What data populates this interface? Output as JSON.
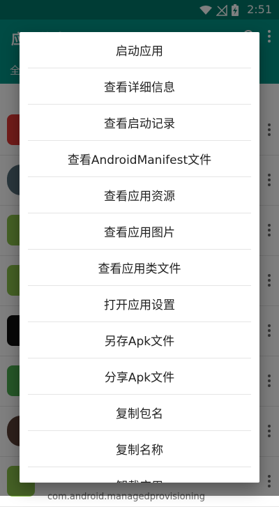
{
  "status_bar": {
    "time": "2:51"
  },
  "app_bar": {
    "title": "应用信息",
    "tab_label": "全部"
  },
  "list": {
    "items": [
      {
        "icon": "red-app-icon",
        "color": "#e53935"
      },
      {
        "icon": "grey-circle-app-icon",
        "color": "#546e7a"
      },
      {
        "icon": "android-icon",
        "color": "#8bc34a"
      },
      {
        "icon": "android-icon",
        "color": "#8bc34a"
      },
      {
        "icon": "tiktok-icon",
        "color": "#111111"
      },
      {
        "icon": "contacts-icon",
        "color": "#4caf50"
      },
      {
        "icon": "avatar-icon",
        "color": "#5d4037"
      },
      {
        "icon": "android-icon",
        "color": "#8bc34a",
        "package": "com.android.managedprovisioning"
      }
    ]
  },
  "menu": {
    "items": [
      {
        "label": "启动应用"
      },
      {
        "label": "查看详细信息"
      },
      {
        "label": "查看启动记录"
      },
      {
        "label": "查看AndroidManifest文件"
      },
      {
        "label": "查看应用资源"
      },
      {
        "label": "查看应用图片"
      },
      {
        "label": "查看应用类文件"
      },
      {
        "label": "打开应用设置"
      },
      {
        "label": "另存Apk文件"
      },
      {
        "label": "分享Apk文件"
      },
      {
        "label": "复制包名"
      },
      {
        "label": "复制名称"
      },
      {
        "label": "卸载应用"
      }
    ]
  },
  "colors": {
    "primary": "#009688",
    "primary_dark": "#00796b"
  }
}
